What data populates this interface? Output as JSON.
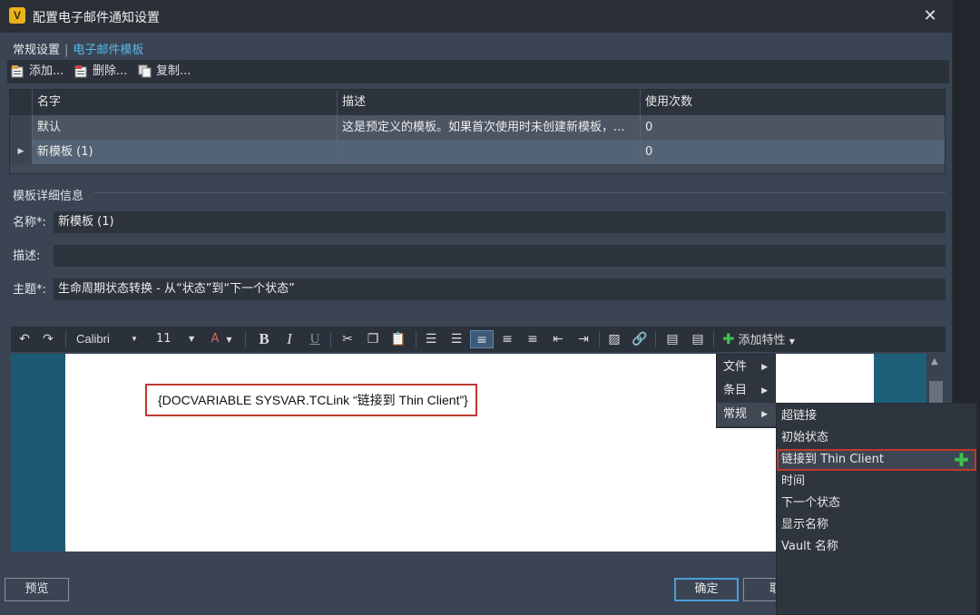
{
  "window": {
    "title": "配置电子邮件通知设置",
    "app_icon": "V"
  },
  "tabs": [
    {
      "label": "常规设置",
      "active": false
    },
    {
      "label": "电子邮件模板",
      "active": true
    }
  ],
  "toolbar": {
    "add_label": "添加...",
    "delete_label": "删除...",
    "copy_label": "复制..."
  },
  "table": {
    "columns": [
      "名字",
      "描述",
      "使用次数"
    ],
    "rows": [
      {
        "name": "默认",
        "description": "这是预定义的模板。如果首次使用时未创建新模板，...",
        "count": "0"
      },
      {
        "name": "新模板 (1)",
        "description": "",
        "count": "0"
      }
    ]
  },
  "details": {
    "section_label": "模板详细信息",
    "name_label": "名称*:",
    "name_value": "新模板 (1)",
    "desc_label": "描述:",
    "desc_value": "",
    "subject_label": "主题*:",
    "subject_value": "生命周期状态转换 - 从“状态”到“下一个状态”"
  },
  "editor": {
    "font": "Calibri",
    "size": "11",
    "add_property_label": "添加特性",
    "field_code": "{DOCVARIABLE SYSVAR.TCLink “链接到 Thin Client”}"
  },
  "menu": {
    "items": [
      "文件",
      "条目",
      "常规"
    ],
    "submenu": [
      "超链接",
      "初始状态",
      "链接到 Thin Client",
      "时间",
      "下一个状态",
      "显示名称",
      "Vault 名称"
    ]
  },
  "buttons": {
    "preview": "预览",
    "ok": "确定",
    "cancel": "取"
  },
  "colors": {
    "accent": "#58b7e8",
    "highlight_border": "#c0392b",
    "add_green": "#3ec24a"
  }
}
